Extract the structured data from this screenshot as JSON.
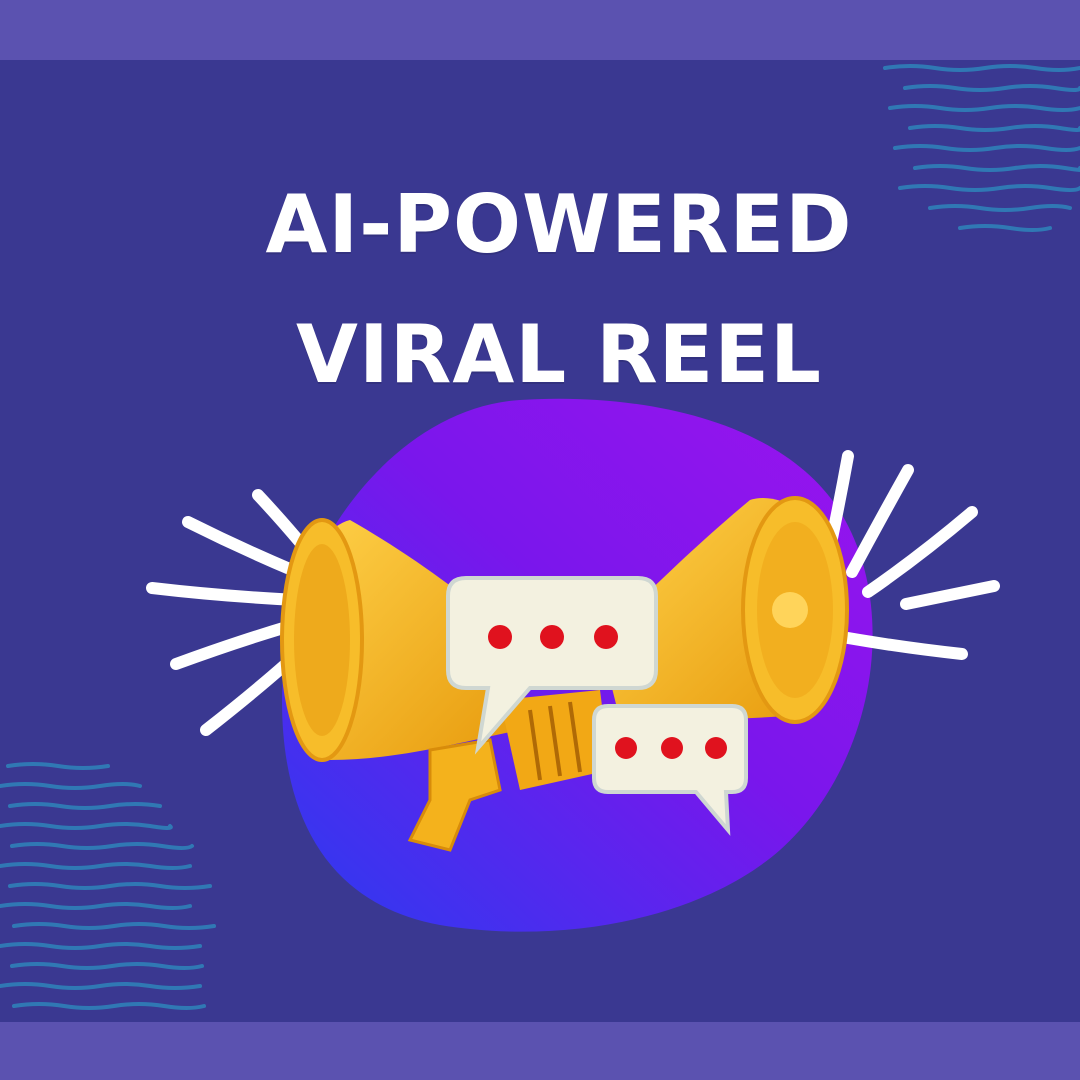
{
  "headline": {
    "line1": "AI-POWERED",
    "line2": "VIRAL REEL"
  },
  "colors": {
    "background": "#3a3891",
    "band": "#5b52b0",
    "blob_start": "#2a3cf0",
    "blob_end": "#9b14ee",
    "megaphone": "#f6b21a",
    "bubble": "#f3f1e0",
    "dots": "#e0121e",
    "waves": "#2f7fb8",
    "headline_text": "#ffffff"
  },
  "icons": {
    "left_megaphone": "megaphone-icon",
    "right_megaphone": "megaphone-icon",
    "large_bubble": "chat-bubble-icon",
    "small_bubble": "chat-bubble-icon"
  }
}
